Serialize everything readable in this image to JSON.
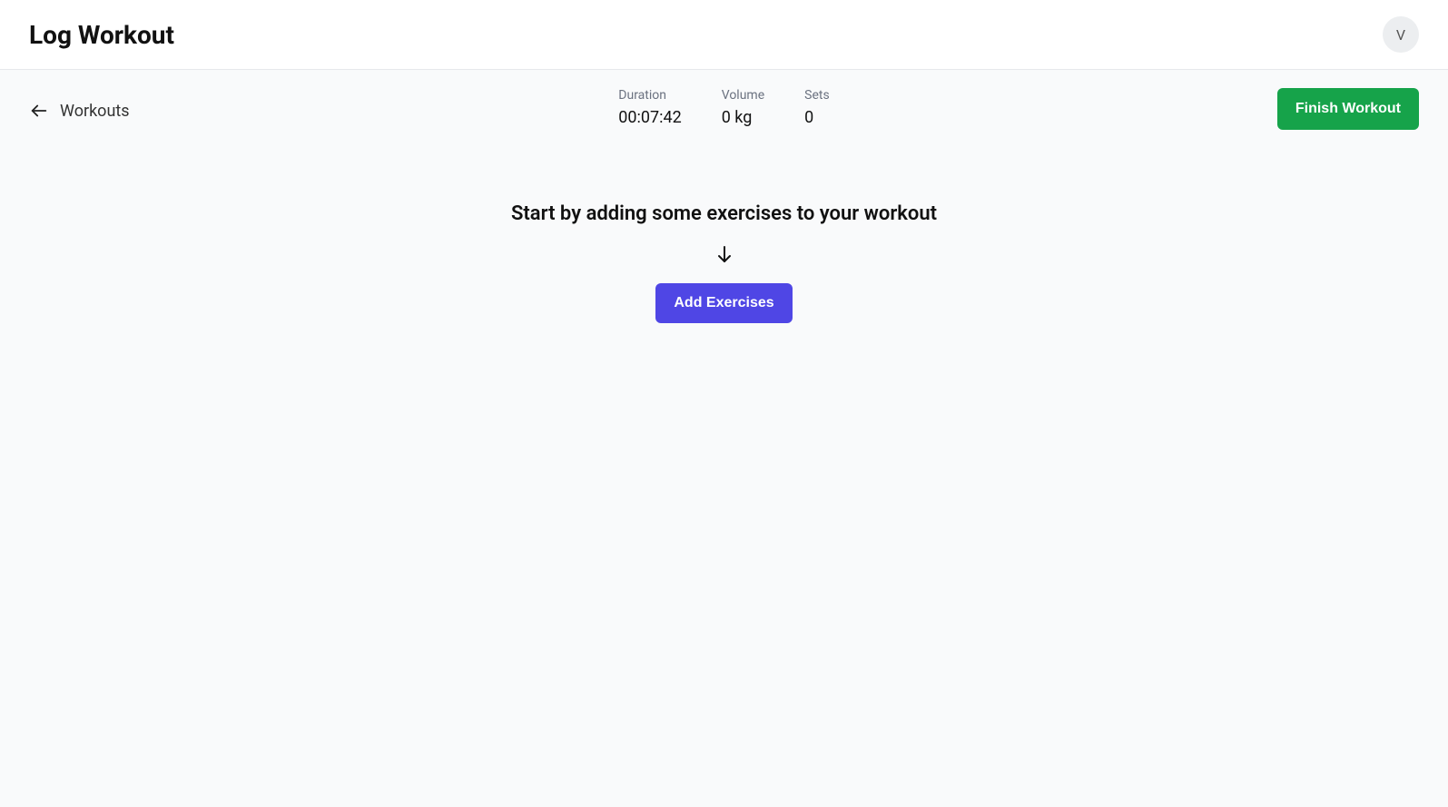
{
  "header": {
    "title": "Log Workout",
    "avatar_initial": "V"
  },
  "nav": {
    "back_label": "Workouts"
  },
  "stats": {
    "duration": {
      "label": "Duration",
      "value": "00:07:42"
    },
    "volume": {
      "label": "Volume",
      "value": "0 kg"
    },
    "sets": {
      "label": "Sets",
      "value": "0"
    }
  },
  "actions": {
    "finish_label": "Finish Workout",
    "add_exercises_label": "Add Exercises"
  },
  "empty": {
    "heading": "Start by adding some exercises to your workout"
  }
}
